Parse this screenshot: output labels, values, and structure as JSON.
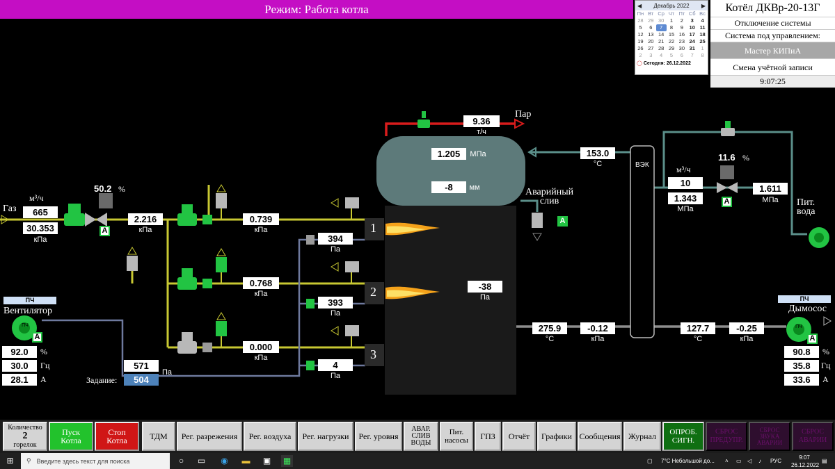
{
  "header": {
    "mode": "Режим: Работа котла"
  },
  "calendar": {
    "month": "Декабрь 2022",
    "weekdays": [
      "Пн",
      "Вт",
      "Ср",
      "Чт",
      "Пт",
      "Сб",
      "Вс"
    ],
    "days": [
      [
        "28",
        "29",
        "30",
        "1",
        "2",
        "3",
        "4"
      ],
      [
        "5",
        "6",
        "7",
        "8",
        "9",
        "10",
        "11"
      ],
      [
        "12",
        "13",
        "14",
        "15",
        "16",
        "17",
        "18"
      ],
      [
        "19",
        "20",
        "21",
        "22",
        "23",
        "24",
        "25"
      ],
      [
        "26",
        "27",
        "28",
        "29",
        "30",
        "31",
        "1"
      ],
      [
        "2",
        "3",
        "4",
        "5",
        "6",
        "7",
        "8"
      ]
    ],
    "today": "Сегодня: 26.12.2022"
  },
  "panel": {
    "title": "Котёл ДКВр-20-13Г",
    "shutdown": "Отключение системы",
    "control_label": "Система под управлением:",
    "operator": "Мастер КИПиА",
    "switch_account": "Смена учётной записи",
    "time": "9:07:25"
  },
  "gas": {
    "label": "Газ",
    "flow_unit": "м³/ч",
    "flow": "665",
    "pressure": "30.353",
    "pressure_unit": "кПа",
    "valve_pos": "50.2",
    "valve_pos_unit": "%",
    "mode_A": "A",
    "p_after": "2.216",
    "p_after_unit": "кПа"
  },
  "burners": [
    {
      "num": "1",
      "gas_p": "0.739",
      "gas_unit": "кПа",
      "air_p": "394",
      "air_unit": "Па"
    },
    {
      "num": "2",
      "gas_p": "0.768",
      "gas_unit": "кПа",
      "air_p": "393",
      "air_unit": "Па"
    },
    {
      "num": "3",
      "gas_p": "0.000",
      "gas_unit": "кПа",
      "air_p": "4",
      "air_unit": "Па"
    }
  ],
  "steam": {
    "label": "Пар",
    "flow": "9.36",
    "flow_unit": "т/ч"
  },
  "drum": {
    "pressure": "1.205",
    "pressure_unit": "МПа",
    "level": "-8",
    "level_unit": "мм"
  },
  "emergency": {
    "label": "Аварийный\nслив",
    "mode_A": "A"
  },
  "furnace": {
    "vacuum": "-38",
    "vacuum_unit": "Па"
  },
  "feedwater": {
    "temp": "153.0",
    "temp_unit": "°C",
    "econ_label": "ВЭК",
    "flow_unit": "м³/ч",
    "flow": "10",
    "pressure": "1.343",
    "pressure_unit": "МПа",
    "valve_pos": "11.6",
    "valve_pos_unit": "%",
    "mode_A": "A",
    "p2": "1.611",
    "p2_unit": "МПа",
    "label": "Пит.\nвода"
  },
  "flue": {
    "t1": "275.9",
    "t1_unit": "°C",
    "p1": "-0.12",
    "p1_unit": "кПа",
    "t2": "127.7",
    "t2_unit": "°C",
    "p2": "-0.25",
    "p2_unit": "кПа"
  },
  "fan": {
    "label": "Вентилятор",
    "pch": "ПЧ",
    "inner": "ПЧ",
    "mode_A": "A",
    "load": "92.0",
    "load_unit": "%",
    "freq": "30.0",
    "freq_unit": "Гц",
    "current": "28.1",
    "current_unit": "А",
    "air_p": "571",
    "air_p_unit": "Па",
    "setpoint_label": "Задание:",
    "setpoint": "504"
  },
  "exhauster": {
    "label": "Дымосос",
    "pch": "ПЧ",
    "inner": "ПЧ",
    "mode_A": "A",
    "load": "90.8",
    "load_unit": "%",
    "freq": "35.8",
    "freq_unit": "Гц",
    "current": "33.6",
    "current_unit": "А"
  },
  "toolbar": {
    "burner_count_label": "Количество",
    "burner_count": "2",
    "burner_count_unit": "горелок",
    "start": "Пуск\nКотла",
    "stop": "Стоп\nКотла",
    "tdm": "ТДМ",
    "reg_vac": "Рег. разрежения",
    "reg_air": "Рег. воздуха",
    "reg_load": "Рег. нагрузки",
    "reg_level": "Рег. уровня",
    "emerg_drain": "АВАР.\nСЛИВ\nВОДЫ",
    "feed_pumps": "Пит.\nнасосы",
    "gpz": "ГПЗ",
    "report": "Отчёт",
    "charts": "Графики",
    "messages": "Сообщения",
    "journal": "Журнал",
    "test_sig": "ОПРОБ.\nСИГН.",
    "reset_warn": "СБРОС\nПРЕДУПР.",
    "reset_sound": "СБРОС\nЗВУКА\nАВАРИИ",
    "reset_alarm": "СБРОС\nАВАРИИ"
  },
  "taskbar": {
    "search_placeholder": "Введите здесь текст для поиска",
    "weather": "7°C  Небольшой до...",
    "lang": "РУС",
    "time": "9:07",
    "date": "26.12.2022"
  }
}
